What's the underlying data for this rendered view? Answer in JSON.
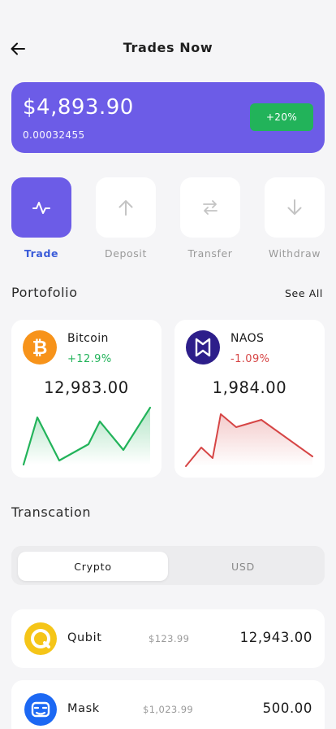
{
  "header": {
    "title": "Trades Now",
    "back_icon": "arrow-left-icon"
  },
  "balance": {
    "amount": "$4,893.90",
    "sub": "0.00032455",
    "change": "+20%",
    "card_color": "#6c5ce7",
    "badge_color": "#22b35a"
  },
  "actions": [
    {
      "label": "Trade",
      "icon": "activity-icon",
      "active": true
    },
    {
      "label": "Deposit",
      "icon": "arrow-up-icon",
      "active": false
    },
    {
      "label": "Transfer",
      "icon": "swap-icon",
      "active": false
    },
    {
      "label": "Withdraw",
      "icon": "arrow-down-icon",
      "active": false
    }
  ],
  "portfolio": {
    "title": "Portofolio",
    "see_all": "See All",
    "coins": [
      {
        "name": "Bitcoin",
        "change": "+12.9%",
        "value": "12,983.00",
        "icon": "bitcoin-icon",
        "color": "#22b35a",
        "logo_color": "#f7931a"
      },
      {
        "name": "NAOS",
        "change": "-1.09%",
        "value": "1,984.00",
        "icon": "naos-icon",
        "color": "#d64545",
        "logo_color": "#2d1e8a"
      }
    ]
  },
  "transaction": {
    "title": "Transcation",
    "tabs": [
      {
        "label": "Crypto",
        "active": true
      },
      {
        "label": "USD",
        "active": false
      }
    ],
    "rows": [
      {
        "name": "Qubit",
        "price": "$123.99",
        "amount": "12,943.00",
        "icon": "qubit-icon",
        "logo_color": "#f5c518"
      },
      {
        "name": "Mask",
        "price": "$1,023.99",
        "amount": "500.00",
        "icon": "mask-icon",
        "logo_color": "#1c68f3"
      }
    ]
  }
}
